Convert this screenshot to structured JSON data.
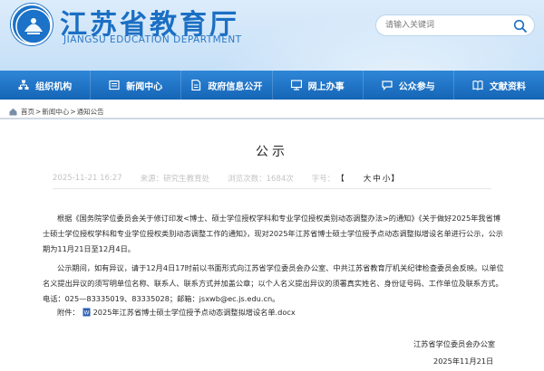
{
  "header": {
    "title": "江苏省教育厅",
    "subtitle": "JIANGSU EDUCATION DEPARTMENT",
    "search_placeholder": "请输入关键词",
    "colors": {
      "brand_blue": "#1b6fc3",
      "nav_blue": "#1b6fc3"
    }
  },
  "nav": {
    "items": [
      {
        "label": "组织机构",
        "icon": "org-chart-icon"
      },
      {
        "label": "新闻中心",
        "icon": "news-icon"
      },
      {
        "label": "政府信息公开",
        "icon": "document-icon"
      },
      {
        "label": "网上办事",
        "icon": "monitor-icon"
      },
      {
        "label": "公众参与",
        "icon": "chat-icon"
      },
      {
        "label": "文献资料",
        "icon": "book-icon"
      }
    ]
  },
  "breadcrumb": {
    "home": "首页",
    "sep1": ">",
    "section": "新闻中心",
    "sep2": ">",
    "current": "通知公告"
  },
  "article": {
    "title": "公示",
    "date": "2025-11-21 16:27",
    "source": "来源：研究生教育处",
    "views": "浏览次数：1684次",
    "font_size_label": "字号：",
    "sizes_open": "【",
    "size_large": "大",
    "size_medium": "中",
    "size_small": "小",
    "sizes_close": "】",
    "paragraph1": "根据《国务院学位委员会关于修订印发<博士、硕士学位授权学科和专业学位授权类别动态调整办法>的通知》《关于做好2025年我省博士硕士学位授权学科和专业学位授权类别动态调整工作的通知》，现对2025年江苏省博士硕士学位授予点动态调整拟增设名单进行公示，公示期为11月21日至12月4日。",
    "paragraph2": "公示期间，如有异议，请于12月4日17时前以书面形式向江苏省学位委员会办公室、中共江苏省教育厅机关纪律检查委员会反映。以单位名义提出异议的须写明单位名称、联系人、联系方式并加盖公章；以个人名义提出异议的须署真实姓名、身份证号码、工作单位及联系方式。电话：025—83335019、83335028；邮箱：jsxwb@ec.js.edu.cn。",
    "attachment_label": "附件：",
    "attachment_name": "2025年江苏省博士硕士学位授予点动态调整拟增设名单.docx",
    "signature_org": "江苏省学位委员会办公室",
    "signature_date": "2025年11月21日"
  }
}
